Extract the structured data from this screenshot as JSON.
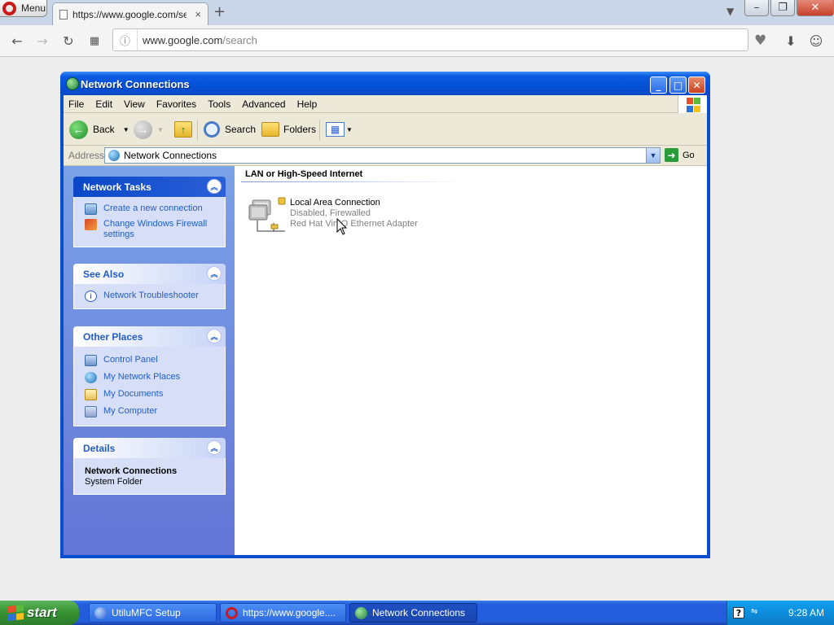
{
  "browser": {
    "menu_label": "Menu",
    "tab_title": "https://www.google.com/se",
    "tab_close": "×",
    "new_tab": "+",
    "url_host": "www.google.com",
    "url_path": "/search"
  },
  "window": {
    "title": "Network Connections",
    "menus": [
      "File",
      "Edit",
      "View",
      "Favorites",
      "Tools",
      "Advanced",
      "Help"
    ],
    "toolbar": {
      "back": "Back",
      "search": "Search",
      "folders": "Folders"
    },
    "address": {
      "label": "Address",
      "value": "Network Connections",
      "go": "Go"
    }
  },
  "left_pane": {
    "network_tasks": {
      "title": "Network Tasks",
      "items": [
        "Create a new connection",
        "Change Windows Firewall settings"
      ]
    },
    "see_also": {
      "title": "See Also",
      "items": [
        "Network Troubleshooter"
      ]
    },
    "other_places": {
      "title": "Other Places",
      "items": [
        "Control Panel",
        "My Network Places",
        "My Documents",
        "My Computer"
      ]
    },
    "details": {
      "title": "Details",
      "name": "Network Connections",
      "type": "System Folder"
    }
  },
  "content": {
    "group_title": "LAN or High-Speed Internet",
    "connection": {
      "name": "Local Area Connection",
      "status": "Disabled, Firewalled",
      "device": "Red Hat VirtIO Ethernet Adapter"
    }
  },
  "taskbar": {
    "start": "start",
    "tasks": [
      "UtiluMFC Setup",
      "https://www.google....",
      "Network Connections"
    ],
    "clock": "9:28 AM"
  },
  "colors": {
    "xp_blue": "#0a4ed0",
    "link_blue": "#215dc6",
    "start_green": "#389434",
    "opera_red": "#cc1a1a"
  }
}
